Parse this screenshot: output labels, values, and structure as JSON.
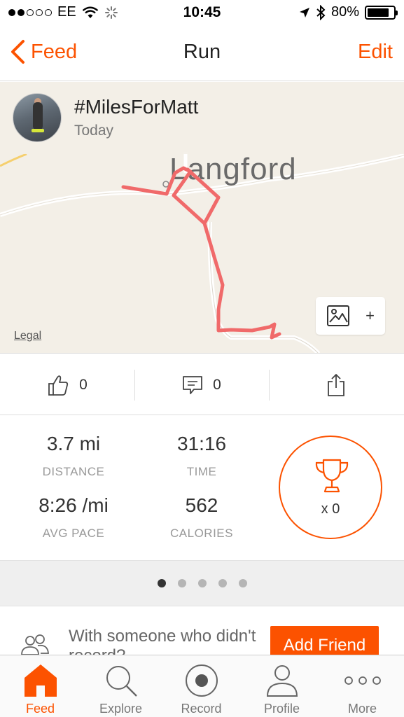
{
  "status_bar": {
    "carrier": "EE",
    "time": "10:45",
    "battery": "80%",
    "icons": [
      "signal-dots-icon",
      "wifi-icon",
      "activity-spinner-icon",
      "location-arrow-icon",
      "bluetooth-icon",
      "battery-icon"
    ]
  },
  "nav": {
    "back_label": "Feed",
    "title": "Run",
    "edit_label": "Edit"
  },
  "activity": {
    "title": "#MilesForMatt",
    "date": "Today"
  },
  "map": {
    "place_label": "Langford",
    "legal_label": "Legal",
    "route_color": "#f06a6a",
    "photo_plus": "+"
  },
  "actions": {
    "kudos_count": "0",
    "comment_count": "0"
  },
  "stats": {
    "distance_value": "3.7 mi",
    "distance_label": "DISTANCE",
    "time_value": "31:16",
    "time_label": "TIME",
    "pace_value": "8:26 /mi",
    "pace_label": "AVG PACE",
    "calories_value": "562",
    "calories_label": "CALORIES",
    "achievements": "x 0"
  },
  "pager": {
    "total": 5,
    "active_index": 0
  },
  "friend": {
    "prompt": "With someone who didn't record?",
    "button_label": "Add Friend"
  },
  "tabs": [
    {
      "label": "Feed",
      "icon": "home-icon",
      "active": true
    },
    {
      "label": "Explore",
      "icon": "search-icon",
      "active": false
    },
    {
      "label": "Record",
      "icon": "record-icon",
      "active": false
    },
    {
      "label": "Profile",
      "icon": "profile-icon",
      "active": false
    },
    {
      "label": "More",
      "icon": "more-icon",
      "active": false
    }
  ],
  "colors": {
    "accent": "#fc5200",
    "map_background": "#f3efe7"
  }
}
